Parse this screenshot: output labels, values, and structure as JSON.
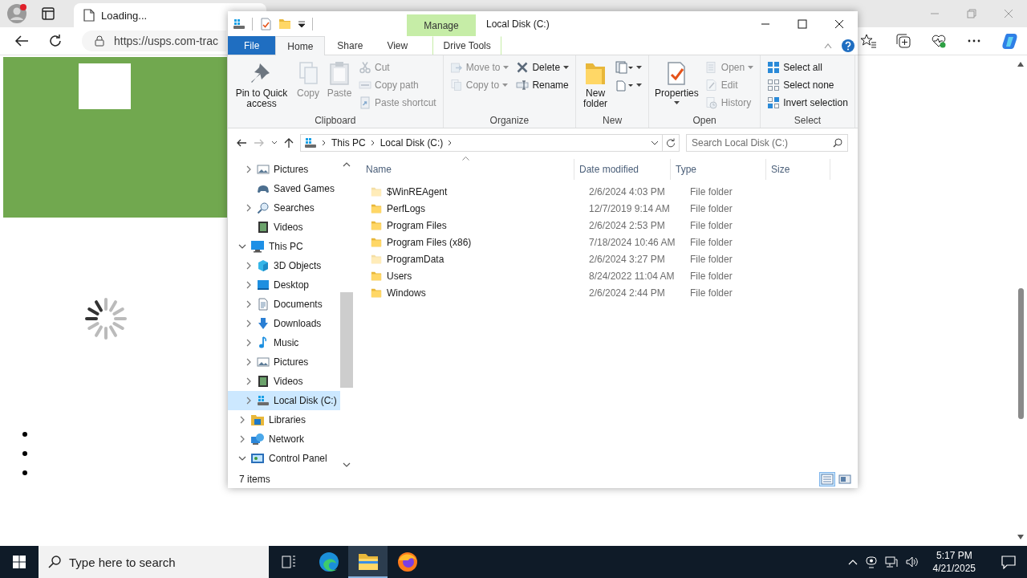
{
  "browser": {
    "tab": {
      "title": "Loading...",
      "selected": true
    },
    "address": "https://usps.com-trac"
  },
  "explorer": {
    "title": "Local Disk (C:)",
    "context_group": "Manage",
    "tabs": [
      {
        "label": "File",
        "kind": "file",
        "selected": false
      },
      {
        "label": "Home",
        "kind": "tab",
        "selected": true
      },
      {
        "label": "Share",
        "kind": "tab",
        "selected": false
      },
      {
        "label": "View",
        "kind": "tab",
        "selected": false
      },
      {
        "label": "Drive Tools",
        "kind": "context",
        "selected": false
      }
    ],
    "ribbon": [
      {
        "label": "Clipboard",
        "columns": [
          {
            "kind": "large",
            "commands": [
              {
                "label": "Pin to Quick access",
                "disabled": false,
                "dropdown": false
              }
            ]
          },
          {
            "kind": "large",
            "commands": [
              {
                "label": "Copy",
                "disabled": true,
                "dropdown": false
              }
            ]
          },
          {
            "kind": "large",
            "commands": [
              {
                "label": "Paste",
                "disabled": true,
                "dropdown": false
              }
            ]
          },
          {
            "kind": "stack",
            "commands": [
              {
                "label": "Cut",
                "disabled": true,
                "dropdown": false
              },
              {
                "label": "Copy path",
                "disabled": true,
                "dropdown": false
              },
              {
                "label": "Paste shortcut",
                "disabled": true,
                "dropdown": false
              }
            ]
          }
        ]
      },
      {
        "label": "Organize",
        "columns": [
          {
            "kind": "stack",
            "commands": [
              {
                "label": "Move to",
                "disabled": true,
                "dropdown": true
              },
              {
                "label": "Copy to",
                "disabled": true,
                "dropdown": true
              }
            ]
          },
          {
            "kind": "stack",
            "commands": [
              {
                "label": "Delete",
                "disabled": false,
                "dropdown": true
              },
              {
                "label": "Rename",
                "disabled": false,
                "dropdown": false
              }
            ]
          }
        ]
      },
      {
        "label": "New",
        "columns": [
          {
            "kind": "large",
            "commands": [
              {
                "label": "New folder",
                "disabled": false,
                "dropdown": false
              }
            ]
          },
          {
            "kind": "stack",
            "commands": [
              {
                "disabled": false,
                "dropdown": true
              },
              {
                "disabled": false,
                "dropdown": true
              }
            ]
          }
        ]
      },
      {
        "label": "Open",
        "columns": [
          {
            "kind": "large",
            "commands": [
              {
                "label": "Properties",
                "disabled": false,
                "dropdown": true
              }
            ]
          },
          {
            "kind": "stack",
            "commands": [
              {
                "label": "Open",
                "disabled": true,
                "dropdown": true
              },
              {
                "label": "Edit",
                "disabled": true,
                "dropdown": false
              },
              {
                "label": "History",
                "disabled": true,
                "dropdown": false
              }
            ]
          }
        ]
      },
      {
        "label": "Select",
        "columns": [
          {
            "kind": "stack",
            "commands": [
              {
                "label": "Select all",
                "disabled": false,
                "dropdown": false
              },
              {
                "label": "Select none",
                "disabled": false,
                "dropdown": false
              },
              {
                "label": "Invert selection",
                "disabled": false,
                "dropdown": false
              }
            ]
          }
        ]
      }
    ],
    "address": {
      "crumbs": [
        "This PC",
        "Local Disk (C:)"
      ],
      "search_placeholder": "Search Local Disk (C:)"
    },
    "nav": {
      "continued": [
        {
          "label": "Pictures",
          "expandable": true,
          "expanded": false,
          "selected": false
        },
        {
          "label": "Saved Games",
          "expandable": false,
          "selected": false
        },
        {
          "label": "Searches",
          "expandable": true,
          "expanded": false,
          "selected": false
        },
        {
          "label": "Videos",
          "expandable": false,
          "selected": false
        }
      ],
      "items": [
        {
          "label": "This PC",
          "expandable": true,
          "expanded": true,
          "selected": false,
          "children": [
            {
              "label": "3D Objects",
              "expandable": true,
              "expanded": false,
              "selected": false
            },
            {
              "label": "Desktop",
              "expandable": true,
              "expanded": false,
              "selected": false
            },
            {
              "label": "Documents",
              "expandable": true,
              "expanded": false,
              "selected": false
            },
            {
              "label": "Downloads",
              "expandable": true,
              "expanded": false,
              "selected": false
            },
            {
              "label": "Music",
              "expandable": true,
              "expanded": false,
              "selected": false
            },
            {
              "label": "Pictures",
              "expandable": true,
              "expanded": false,
              "selected": false
            },
            {
              "label": "Videos",
              "expandable": true,
              "expanded": false,
              "selected": false
            },
            {
              "label": "Local Disk (C:)",
              "expandable": true,
              "expanded": false,
              "selected": true
            }
          ]
        },
        {
          "label": "Libraries",
          "expandable": true,
          "expanded": false,
          "selected": false
        },
        {
          "label": "Network",
          "expandable": true,
          "expanded": false,
          "selected": false
        },
        {
          "label": "Control Panel",
          "expandable": true,
          "expanded": true,
          "selected": false
        }
      ]
    },
    "files": {
      "columns": [
        "Name",
        "Date modified",
        "Type",
        "Size"
      ],
      "rows": [
        {
          "name": "$WinREAgent",
          "date": "2/6/2024 4:03 PM",
          "type": "File folder",
          "hidden": true
        },
        {
          "name": "PerfLogs",
          "date": "12/7/2019 9:14 AM",
          "type": "File folder",
          "hidden": false
        },
        {
          "name": "Program Files",
          "date": "2/6/2024 2:53 PM",
          "type": "File folder",
          "hidden": false
        },
        {
          "name": "Program Files (x86)",
          "date": "7/18/2024 10:46 AM",
          "type": "File folder",
          "hidden": false
        },
        {
          "name": "ProgramData",
          "date": "2/6/2024 3:27 PM",
          "type": "File folder",
          "hidden": true
        },
        {
          "name": "Users",
          "date": "8/24/2022 11:04 AM",
          "type": "File folder",
          "hidden": false
        },
        {
          "name": "Windows",
          "date": "2/6/2024 2:44 PM",
          "type": "File folder",
          "hidden": false
        }
      ]
    },
    "status": {
      "count": "7 items",
      "views": [
        {
          "kind": "details",
          "selected": true
        },
        {
          "kind": "tiles",
          "selected": false
        }
      ]
    }
  },
  "taskbar": {
    "search_placeholder": "Type here to search",
    "apps": [
      {
        "kind": "edge",
        "selected": false
      },
      {
        "kind": "explorer",
        "selected": true
      },
      {
        "kind": "firefox",
        "selected": false
      }
    ],
    "time": "5:17 PM",
    "date": "4/21/2025"
  }
}
